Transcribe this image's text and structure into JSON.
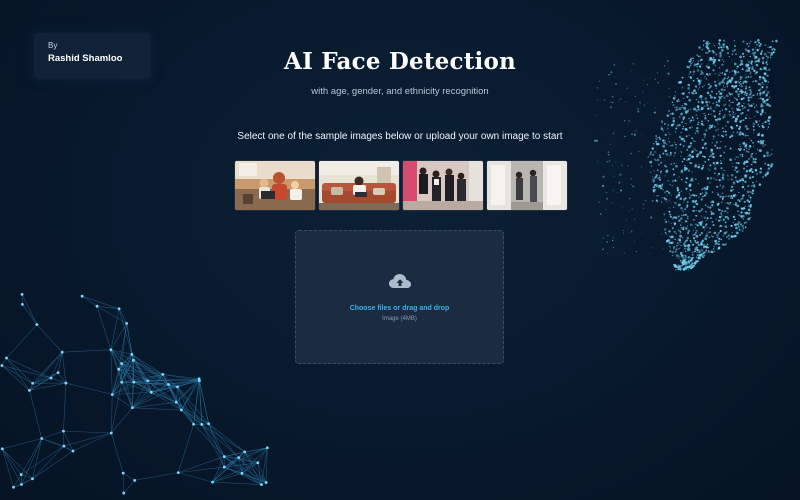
{
  "byline": {
    "by": "By",
    "author": "Rashid Shamloo"
  },
  "header": {
    "title": "AI Face Detection",
    "subtitle": "with age, gender, and ethnicity recognition"
  },
  "instruction": "Select one of the sample images below or upload your own image to start",
  "samples": [
    {
      "icon": "family-photo"
    },
    {
      "icon": "living-room-photo"
    },
    {
      "icon": "group-photo"
    },
    {
      "icon": "hallway-photo"
    }
  ],
  "upload": {
    "icon": "cloud-upload-icon",
    "cta": "Choose files or drag and drop",
    "hint": "Image (4MB)"
  },
  "colors": {
    "background": "#08192c",
    "accent": "#3db0e6",
    "dropzone": "#1b2c40",
    "particles": "#6fd0f2"
  }
}
